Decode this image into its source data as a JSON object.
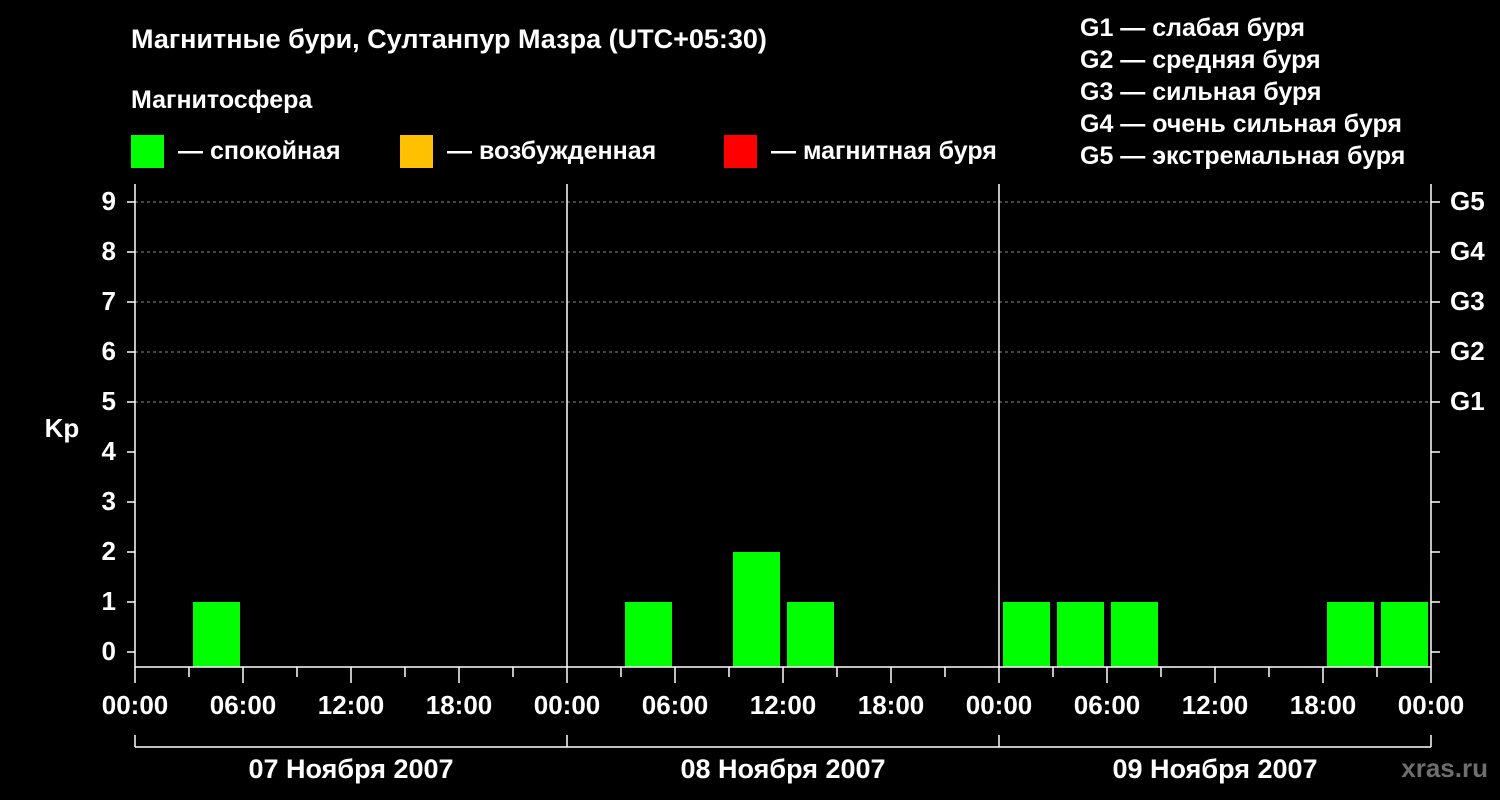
{
  "chart_data": {
    "type": "bar",
    "title": "Магнитные бури, Султанпур Мазра (UTC+05:30)",
    "subtitle": "Магнитосфера",
    "ylabel": "Kp",
    "ylim": [
      0,
      9
    ],
    "yticks": [
      "0",
      "1",
      "2",
      "3",
      "4",
      "5",
      "6",
      "7",
      "8",
      "9"
    ],
    "right_ticks": [
      {
        "kp": 5,
        "label": "G1"
      },
      {
        "kp": 6,
        "label": "G2"
      },
      {
        "kp": 7,
        "label": "G3"
      },
      {
        "kp": 8,
        "label": "G4"
      },
      {
        "kp": 9,
        "label": "G5"
      }
    ],
    "xtick_labels": [
      "00:00",
      "06:00",
      "12:00",
      "18:00",
      "00:00",
      "06:00",
      "12:00",
      "18:00",
      "00:00",
      "06:00",
      "12:00",
      "18:00",
      "00:00"
    ],
    "days": [
      "07 Ноября 2007",
      "08 Ноября 2007",
      "09 Ноября 2007"
    ],
    "bars": [
      {
        "day": 0,
        "hour": 3,
        "kp": 1,
        "status": "quiet"
      },
      {
        "day": 1,
        "hour": 3,
        "kp": 1,
        "status": "quiet"
      },
      {
        "day": 1,
        "hour": 9,
        "kp": 2,
        "status": "quiet"
      },
      {
        "day": 1,
        "hour": 12,
        "kp": 1,
        "status": "quiet"
      },
      {
        "day": 2,
        "hour": 0,
        "kp": 1,
        "status": "quiet"
      },
      {
        "day": 2,
        "hour": 3,
        "kp": 1,
        "status": "quiet"
      },
      {
        "day": 2,
        "hour": 6,
        "kp": 1,
        "status": "quiet"
      },
      {
        "day": 2,
        "hour": 18,
        "kp": 1,
        "status": "quiet"
      },
      {
        "day": 2,
        "hour": 21,
        "kp": 1,
        "status": "quiet"
      }
    ],
    "grid": "dashed at Kp 5–9",
    "colors": {
      "quiet": "#00ff00",
      "active": "#ffc000",
      "storm": "#ff0000"
    }
  },
  "legend": [
    {
      "text": "— спокойная",
      "color": "#00ff00"
    },
    {
      "text": "— возбужденная",
      "color": "#ffc000"
    },
    {
      "text": "— магнитная буря",
      "color": "#ff0000"
    }
  ],
  "storm_levels": [
    "G1 — слабая буря",
    "G2 — средняя буря",
    "G3 — сильная буря",
    "G4 — очень сильная буря",
    "G5 — экстремальная буря"
  ],
  "watermark": "xras.ru"
}
